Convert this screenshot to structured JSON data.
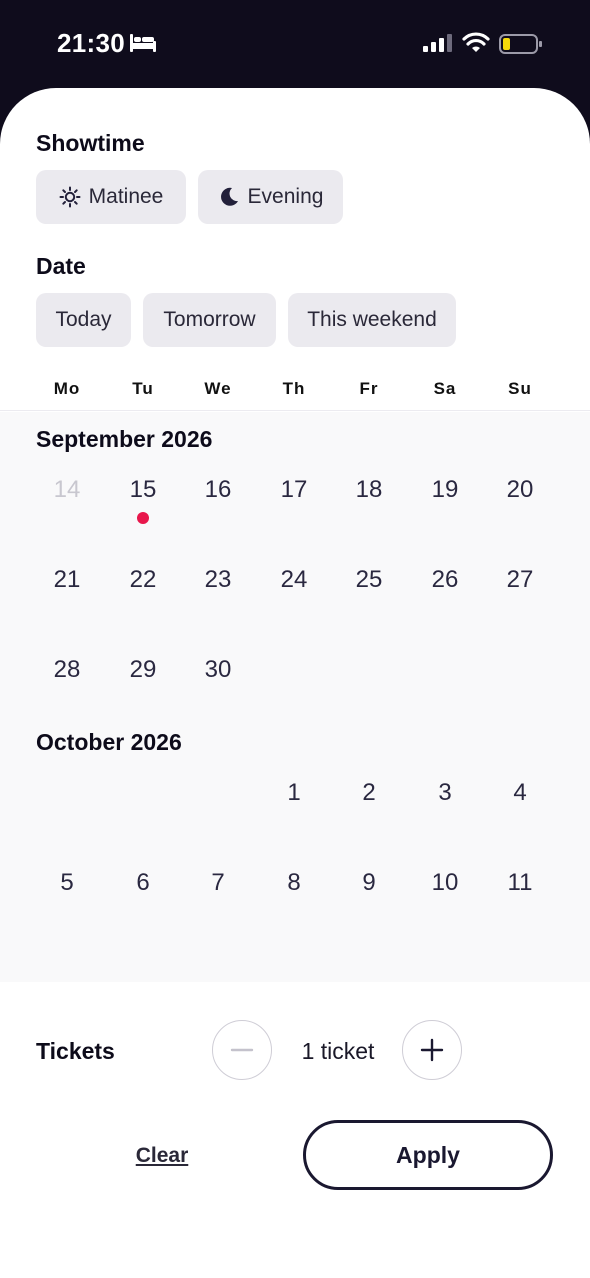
{
  "status_bar": {
    "time": "21:30",
    "icons": [
      "bed-icon",
      "signal-icon",
      "wifi-icon",
      "battery-icon"
    ]
  },
  "showtime": {
    "title": "Showtime",
    "options": [
      {
        "label": "Matinee",
        "icon": "sun-icon"
      },
      {
        "label": "Evening",
        "icon": "moon-icon"
      }
    ]
  },
  "date": {
    "title": "Date",
    "options": [
      "Today",
      "Tomorrow",
      "This weekend"
    ]
  },
  "weekdays": [
    "Mo",
    "Tu",
    "We",
    "Th",
    "Fr",
    "Sa",
    "Su"
  ],
  "calendar": {
    "months": [
      {
        "title": "September 2026",
        "weeks": [
          [
            "14",
            "15",
            "16",
            "17",
            "18",
            "19",
            "20"
          ],
          [
            "21",
            "22",
            "23",
            "24",
            "25",
            "26",
            "27"
          ],
          [
            "28",
            "29",
            "30",
            "",
            "",
            "",
            ""
          ]
        ]
      },
      {
        "title": "October 2026",
        "weeks": [
          [
            "",
            "",
            "",
            "1",
            "2",
            "3",
            "4"
          ],
          [
            "5",
            "6",
            "7",
            "8",
            "9",
            "10",
            "11"
          ]
        ]
      }
    ],
    "past_days": [
      "14"
    ],
    "event_day": "15",
    "event_color": "#e8174b"
  },
  "tickets": {
    "label": "Tickets",
    "count_text": "1 ticket"
  },
  "actions": {
    "clear_label": "Clear",
    "apply_label": "Apply"
  },
  "colors": {
    "background": "#0f0c1c",
    "chip": "#ebeaef",
    "accent_dot": "#e8174b"
  }
}
